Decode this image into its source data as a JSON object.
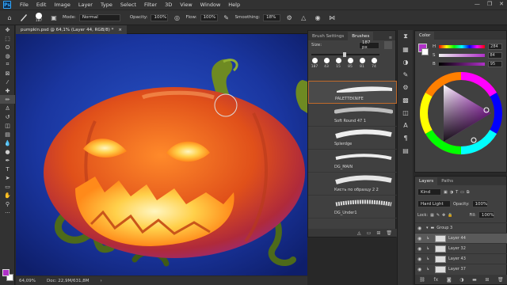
{
  "menubar": {
    "logo": "Ps",
    "items": [
      "File",
      "Edit",
      "Image",
      "Layer",
      "Type",
      "Select",
      "Filter",
      "3D",
      "View",
      "Window",
      "Help"
    ],
    "window_controls": [
      "—",
      "❐",
      "✕"
    ]
  },
  "options": {
    "brush_size": "187",
    "mode_label": "Mode:",
    "mode_value": "Normal",
    "opacity_label": "Opacity:",
    "opacity_value": "100%",
    "flow_label": "Flow:",
    "flow_value": "100%",
    "smoothing_label": "Smoothing:",
    "smoothing_value": "18%"
  },
  "document": {
    "tab_title": "pumpkin.psd @ 64,1% (Layer 44, RGB/8) *",
    "close": "×"
  },
  "status": {
    "zoom": "64,09%",
    "doc": "Doc: 22,9M/631,8M",
    "arrow": "›"
  },
  "brushes_panel": {
    "tabs": [
      "Brush Settings",
      "Brushes"
    ],
    "size_label": "Size:",
    "size_value": "187 px",
    "tip_sizes": [
      "187",
      "43",
      "15",
      "85",
      "81",
      "74"
    ],
    "brushes": [
      {
        "name": "PALETTEKNIFE",
        "selected": true
      },
      {
        "name": "Soft Round 47 1",
        "selected": false
      },
      {
        "name": "Splerdge",
        "selected": false
      },
      {
        "name": "DG_MAIN",
        "selected": false
      },
      {
        "name": "Кисть по образцу 2 2",
        "selected": false
      },
      {
        "name": "DG_Under1",
        "selected": false
      }
    ]
  },
  "color_panel": {
    "tab": "Color",
    "h_label": "H",
    "h_value": "284",
    "s_label": "S",
    "s_value": "84",
    "b_label": "B",
    "b_value": "95",
    "foreground_color": "#b030c8"
  },
  "layers_panel": {
    "tabs": [
      "Layers",
      "Paths"
    ],
    "kind_label": "Kind",
    "blend_mode": "Hard Light",
    "opacity_label": "Opacity:",
    "opacity_value": "100%",
    "lock_label": "Lock:",
    "fill_label": "Fill:",
    "fill_value": "100%",
    "layers": [
      {
        "name": "Group 3",
        "type": "group",
        "selected": false
      },
      {
        "name": "Layer 44",
        "type": "layer",
        "selected": true
      },
      {
        "name": "Layer 32",
        "type": "layer",
        "selected": false
      },
      {
        "name": "Layer 43",
        "type": "layer",
        "selected": false
      },
      {
        "name": "Layer 37",
        "type": "layer",
        "selected": false
      }
    ]
  }
}
